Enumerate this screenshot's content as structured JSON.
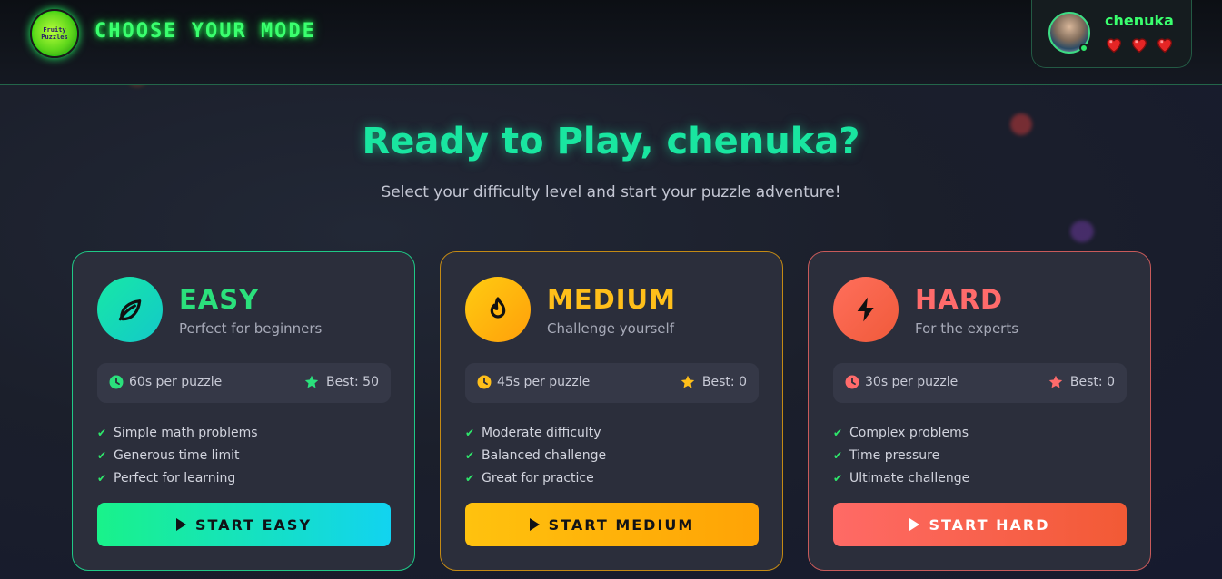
{
  "header": {
    "logo_text": "Fruity\nPuzzles",
    "title": "CHOOSE YOUR MODE",
    "user": {
      "name": "chenuka",
      "hearts": 3
    }
  },
  "hero": {
    "title": "Ready to Play, chenuka?",
    "subtitle": "Select your difficulty level and start your puzzle adventure!"
  },
  "modes": [
    {
      "name": "EASY",
      "description": "Perfect for beginners",
      "icon": "leaf-icon",
      "time": "60s per puzzle",
      "best": "Best: 50",
      "features": [
        "Simple math problems",
        "Generous time limit",
        "Perfect for learning"
      ],
      "button": "START EASY",
      "accent": "#2be07c"
    },
    {
      "name": "MEDIUM",
      "description": "Challenge yourself",
      "icon": "fire-icon",
      "time": "45s per puzzle",
      "best": "Best: 0",
      "features": [
        "Moderate difficulty",
        "Balanced challenge",
        "Great for practice"
      ],
      "button": "START MEDIUM",
      "accent": "#ffbf1a"
    },
    {
      "name": "HARD",
      "description": "For the experts",
      "icon": "lightning-icon",
      "time": "30s per puzzle",
      "best": "Best: 0",
      "features": [
        "Complex problems",
        "Time pressure",
        "Ultimate challenge"
      ],
      "button": "START HARD",
      "accent": "#ff6b6b"
    }
  ]
}
